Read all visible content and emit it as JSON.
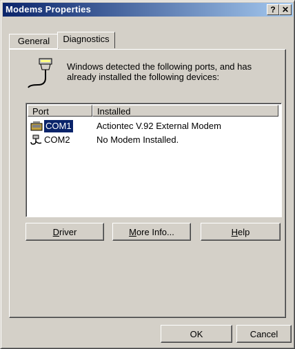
{
  "window": {
    "title": "Modems Properties",
    "help_button": "?",
    "close_button": "✕"
  },
  "tabs": [
    {
      "label": "General"
    },
    {
      "label": "Diagnostics"
    }
  ],
  "diagnostics": {
    "description_line1": "Windows detected the following ports, and has",
    "description_line2": "already installed the following devices:",
    "columns": {
      "port": "Port",
      "installed": "Installed"
    },
    "rows": [
      {
        "port": "COM1",
        "installed": "Actiontec V.92 External Modem",
        "selected": true,
        "icon": "modem-icon"
      },
      {
        "port": "COM2",
        "installed": "No Modem Installed.",
        "selected": false,
        "icon": "port-cable-icon"
      }
    ],
    "buttons": {
      "driver": {
        "accel": "D",
        "rest": "river"
      },
      "more_info": {
        "accel": "M",
        "rest": "ore Info..."
      },
      "help": {
        "accel": "H",
        "rest": "elp"
      }
    }
  },
  "footer": {
    "ok": "OK",
    "cancel": "Cancel"
  },
  "colors": {
    "title_start": "#0a246a",
    "title_end": "#a6caf0",
    "face": "#d4d0c8",
    "selection": "#0a246a"
  }
}
